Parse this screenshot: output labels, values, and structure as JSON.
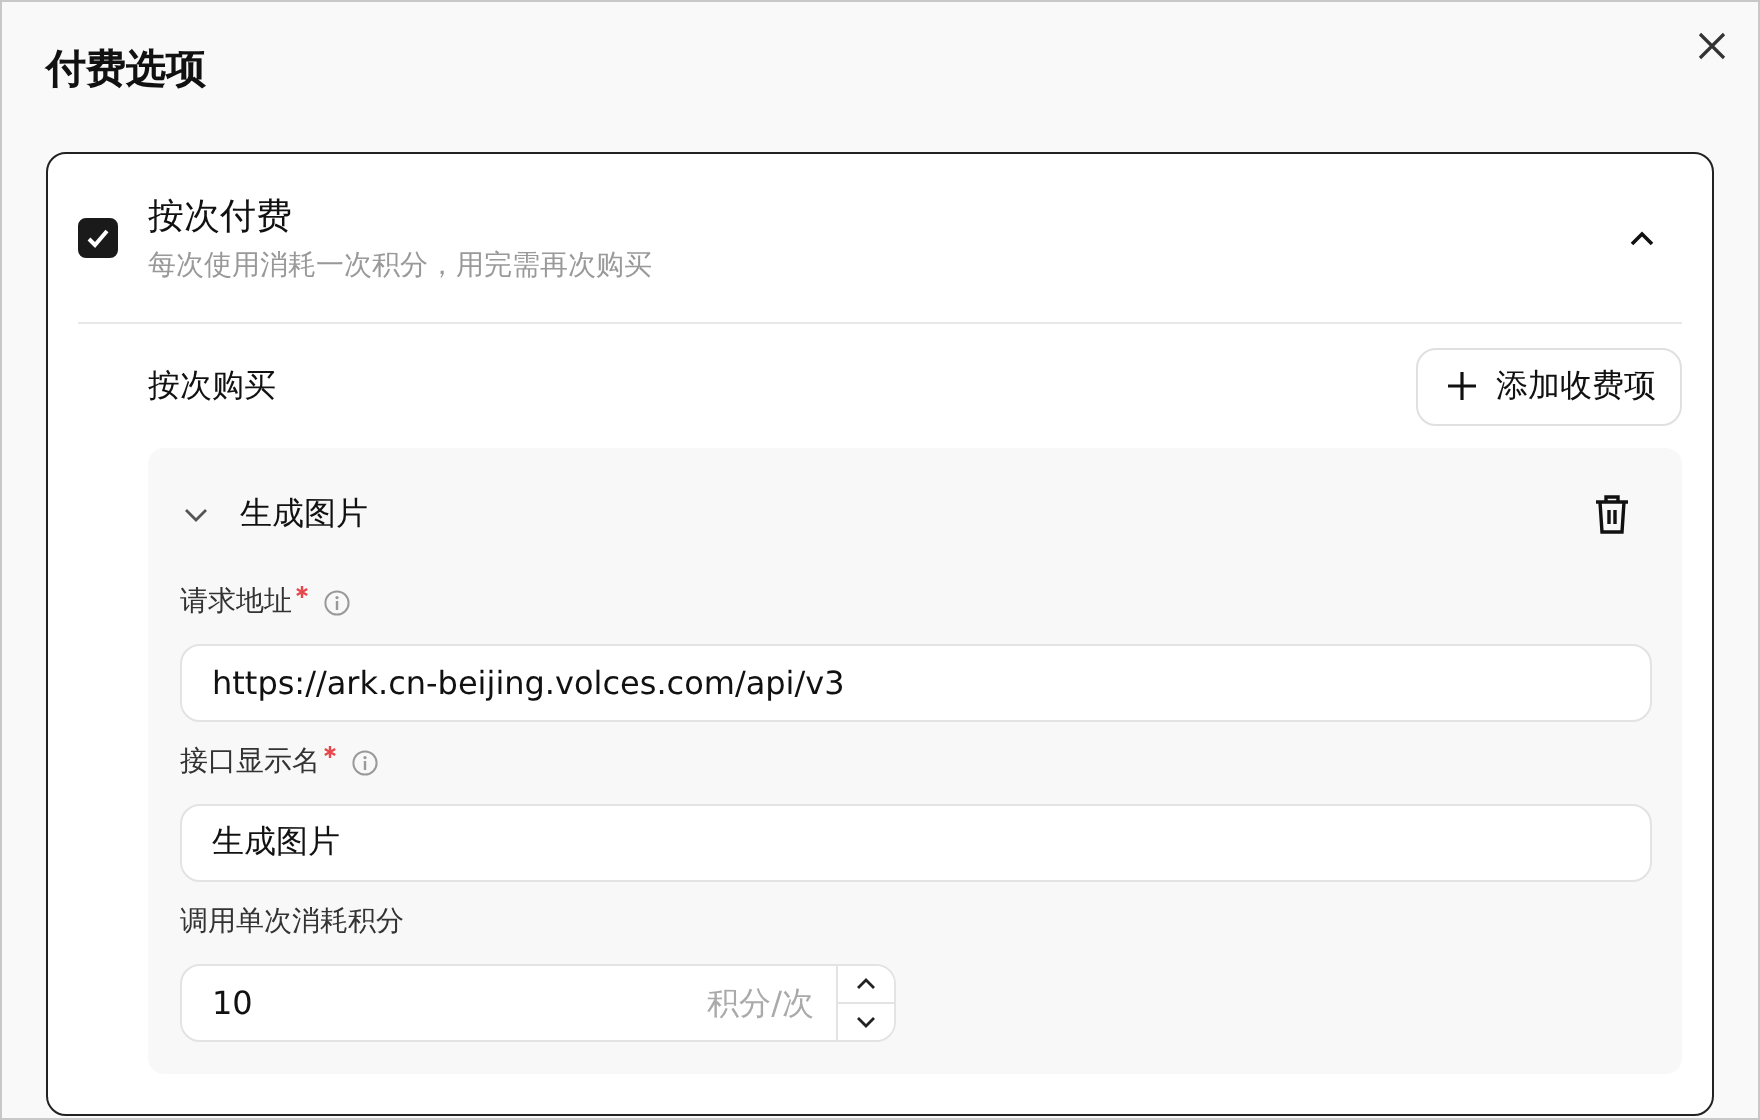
{
  "dialog": {
    "title": "付费选项"
  },
  "option": {
    "title": "按次付费",
    "description": "每次使用消耗一次积分，用完需再次购买",
    "checked": true,
    "expanded": true
  },
  "section": {
    "label": "按次购买",
    "add_button": "添加收费项"
  },
  "items": [
    {
      "title": "生成图片",
      "expanded": true,
      "fields": [
        {
          "kind": "text",
          "label": "请求地址",
          "required": true,
          "info": true,
          "value": "https://ark.cn-beijing.volces.com/api/v3"
        },
        {
          "kind": "text",
          "label": "接口显示名",
          "required": true,
          "info": true,
          "value": "生成图片"
        },
        {
          "kind": "number",
          "label": "调用单次消耗积分",
          "required": false,
          "info": false,
          "value": "10",
          "unit": "积分/次"
        }
      ]
    }
  ]
}
